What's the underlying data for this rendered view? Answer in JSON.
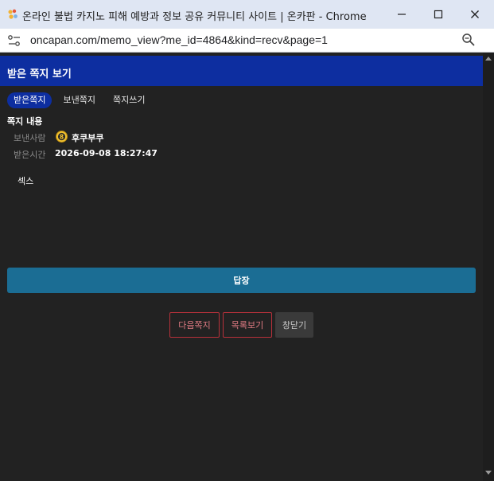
{
  "window": {
    "title": "온라인 불법 카지노 피해 예방과 정보 공유 커뮤니티 사이트 | 온카판 - Chrome",
    "url": "oncapan.com/memo_view?me_id=4864&kind=recv&page=1"
  },
  "header": {
    "title": "받은 쪽지 보기"
  },
  "tabs": [
    {
      "label": "받은쪽지",
      "active": true
    },
    {
      "label": "보낸쪽지",
      "active": false
    },
    {
      "label": "쪽지쓰기",
      "active": false
    }
  ],
  "memo": {
    "section_title": "쪽지 내용",
    "sender_label": "보낸사람",
    "sender_level": "8",
    "sender_name": "후쿠부쿠",
    "time_label": "받은시간",
    "time_value": "2026-09-08 18:27:47",
    "body": "섹스"
  },
  "actions": {
    "reply_label": "답장",
    "next_label": "다음쪽지",
    "list_label": "목록보기",
    "close_label": "창닫기"
  },
  "colors": {
    "header_bg": "#0d2ea0",
    "page_bg": "#222222",
    "reply_bg": "#1b6d94",
    "danger_border": "#b8313b"
  }
}
